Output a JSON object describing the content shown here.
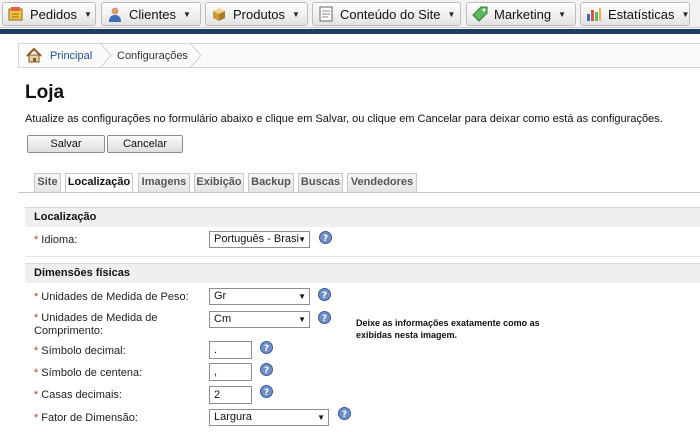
{
  "nav": {
    "items": [
      {
        "label": "Pedidos",
        "icon": "orders-icon"
      },
      {
        "label": "Clientes",
        "icon": "customers-icon"
      },
      {
        "label": "Produtos",
        "icon": "products-icon"
      },
      {
        "label": "Conteúdo do Site",
        "icon": "site-content-icon"
      },
      {
        "label": "Marketing",
        "icon": "marketing-icon"
      },
      {
        "label": "Estatísticas",
        "icon": "statistics-icon"
      }
    ]
  },
  "breadcrumb": {
    "home": "Principal",
    "current": "Configurações"
  },
  "page": {
    "title": "Loja",
    "intro": "Atualize as configurações no formulário abaixo e clique em Salvar, ou clique em Cancelar para deixar como está as configurações.",
    "save": "Salvar",
    "cancel": "Cancelar"
  },
  "tabs": [
    "Site",
    "Localização",
    "Imagens",
    "Exibição",
    "Backup",
    "Buscas",
    "Vendedores"
  ],
  "active_tab": "Localização",
  "sections": {
    "localizacao": "Localização",
    "dimensoes": "Dimensões físicas"
  },
  "fields": {
    "idioma": {
      "label": "Idioma:",
      "value": "Português - Brasi"
    },
    "peso": {
      "label": "Unidades de Medida de Peso:",
      "value": "Gr"
    },
    "comprimento": {
      "label1": "Unidades de Medida de",
      "label2": "Comprimento:",
      "value": "Cm"
    },
    "decimal": {
      "label": "Símbolo decimal:",
      "value": "."
    },
    "centena": {
      "label": "Símbolo de centena:",
      "value": ","
    },
    "casas": {
      "label": "Casas decimais:",
      "value": "2"
    },
    "fator": {
      "label": "Fator de Dimensão:",
      "value": "Largura"
    }
  },
  "required_mark": "*",
  "note": "Deixe as informações exatamente como as exibidas nesta imagem.",
  "colors": {
    "nav_stripe": "#1c3f63",
    "link": "#1f4f8a",
    "required": "#c0392b"
  }
}
